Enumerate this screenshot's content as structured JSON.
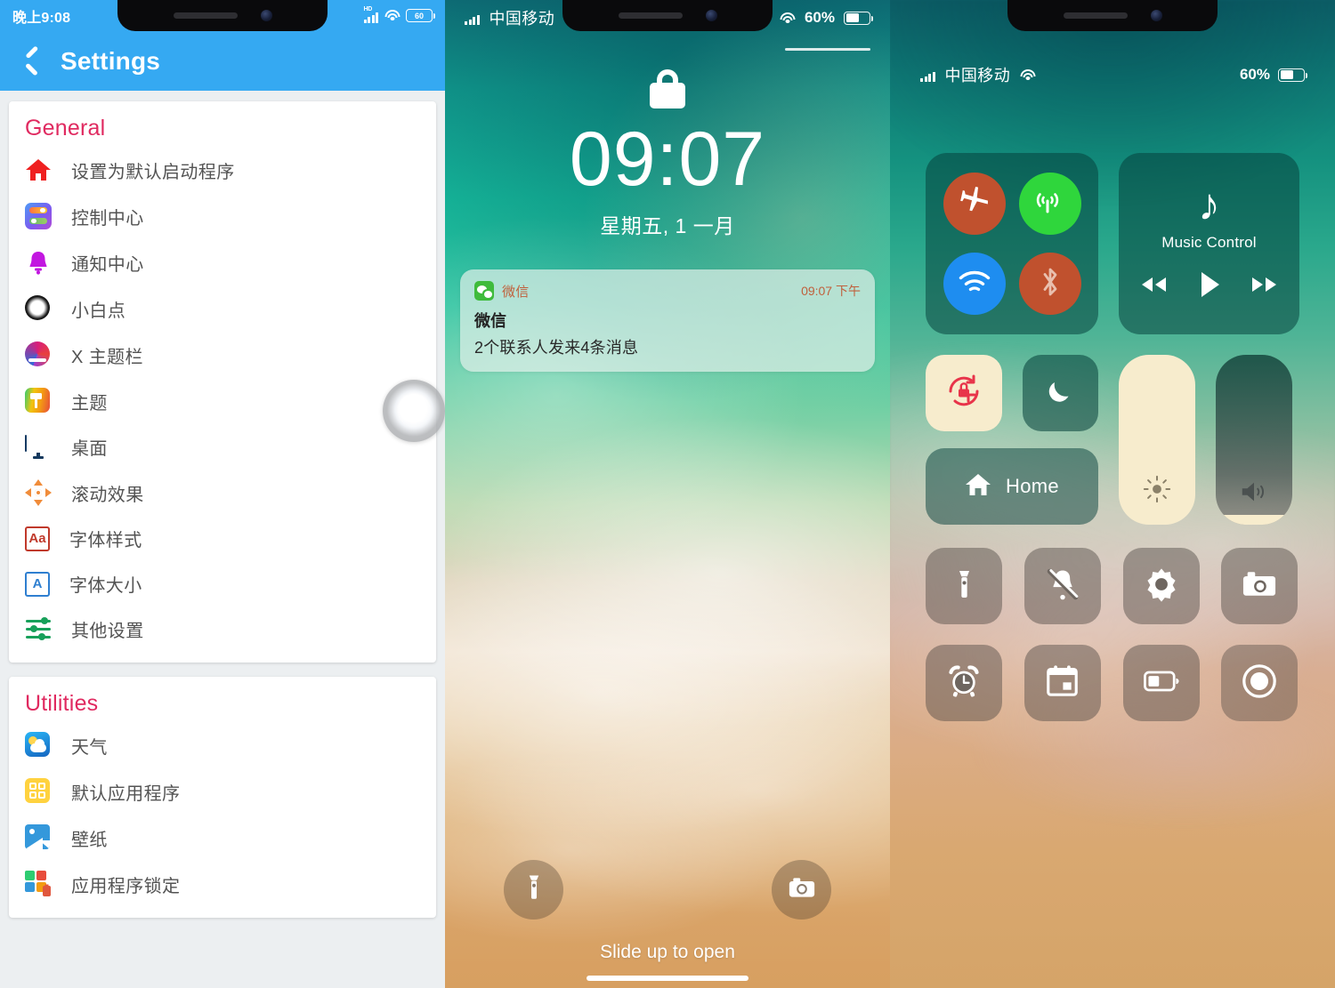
{
  "panel_settings": {
    "status_bar": {
      "time": "晚上9:08",
      "network_label": "HD",
      "signal_icon": "signal-bars-icon",
      "wifi_icon": "wifi-icon",
      "battery_level": "60"
    },
    "header": {
      "back_icon": "back-chevron-icon",
      "title": "Settings"
    },
    "sections": [
      {
        "title": "General",
        "items": [
          {
            "icon": "home-icon",
            "label": "设置为默认启动程序"
          },
          {
            "icon": "control-center-icon",
            "label": "控制中心"
          },
          {
            "icon": "bell-icon",
            "label": "通知中心"
          },
          {
            "icon": "assistive-touch-icon",
            "label": "小白点"
          },
          {
            "icon": "x-status-bar-icon",
            "label": "X 主题栏"
          },
          {
            "icon": "theme-paint-icon",
            "label": "主题"
          },
          {
            "icon": "desktop-monitor-icon",
            "label": "桌面"
          },
          {
            "icon": "scroll-effect-icon",
            "label": "滚动效果"
          },
          {
            "icon": "font-style-icon",
            "label": "字体样式",
            "glyph": "Aa"
          },
          {
            "icon": "font-size-icon",
            "label": "字体大小",
            "glyph": "A"
          },
          {
            "icon": "sliders-icon",
            "label": "其他设置"
          }
        ]
      },
      {
        "title": "Utilities",
        "items": [
          {
            "icon": "weather-icon",
            "label": "天气"
          },
          {
            "icon": "default-apps-icon",
            "label": "默认应用程序"
          },
          {
            "icon": "wallpaper-icon",
            "label": "壁纸"
          },
          {
            "icon": "app-lock-icon",
            "label": "应用程序锁定"
          }
        ]
      }
    ],
    "accent_color": "#e02a60",
    "header_color": "#35a9f2",
    "assistive_touch": {
      "icon": "assistive-touch-button"
    }
  },
  "panel_lockscreen": {
    "status_bar": {
      "signal_icon": "signal-bars-icon",
      "carrier": "中国移动",
      "wifi_icon": "wifi-icon",
      "battery_percent": "60%",
      "battery_level": 60
    },
    "lock_icon": "padlock-icon",
    "clock": {
      "time": "09:07",
      "date": "星期五, 1 一月"
    },
    "notification": {
      "app_icon": "wechat-icon",
      "app_name": "微信",
      "time": "09:07 下午",
      "title": "微信",
      "message": "2个联系人发来4条消息"
    },
    "shortcuts": [
      {
        "icon": "flashlight-icon",
        "name": "flashlight"
      },
      {
        "icon": "camera-icon",
        "name": "camera"
      }
    ],
    "slide_hint": "Slide up to open",
    "home_indicator": "home-bar"
  },
  "panel_controlcenter": {
    "status_bar": {
      "signal_icon": "signal-bars-icon",
      "carrier": "中国移动",
      "wifi_icon": "wifi-icon",
      "battery_percent": "60%",
      "battery_level": 60
    },
    "connectivity": [
      {
        "icon": "airplane-mode-icon",
        "name": "airplane-mode",
        "state": "off",
        "color": "#c0512e"
      },
      {
        "icon": "cellular-data-icon",
        "name": "cellular-data",
        "state": "on",
        "color": "#2fd63c"
      },
      {
        "icon": "wifi-icon",
        "name": "wifi",
        "state": "on",
        "color": "#1e8df0"
      },
      {
        "icon": "bluetooth-icon",
        "name": "bluetooth",
        "state": "off",
        "color": "#c0512e"
      }
    ],
    "music": {
      "icon": "music-note-icon",
      "label": "Music Control",
      "prev": "rewind-icon",
      "play": "play-icon",
      "next": "fast-forward-icon"
    },
    "toggles": [
      {
        "icon": "rotation-lock-icon",
        "name": "rotation-lock",
        "state": "on"
      },
      {
        "icon": "moon-icon",
        "name": "do-not-disturb",
        "state": "off"
      }
    ],
    "home_tile": {
      "icon": "home-icon",
      "label": "Home"
    },
    "sliders": [
      {
        "icon": "brightness-icon",
        "name": "brightness",
        "value": 100
      },
      {
        "icon": "volume-icon",
        "name": "volume",
        "value": 6
      }
    ],
    "utilities": [
      {
        "icon": "flashlight-icon",
        "name": "flashlight"
      },
      {
        "icon": "mute-bell-icon",
        "name": "silent-mode"
      },
      {
        "icon": "brightness-icon",
        "name": "brightness-shortcut"
      },
      {
        "icon": "camera-icon",
        "name": "camera"
      },
      {
        "icon": "alarm-clock-icon",
        "name": "alarm"
      },
      {
        "icon": "calendar-icon",
        "name": "calendar"
      },
      {
        "icon": "battery-icon",
        "name": "low-power-mode"
      },
      {
        "icon": "record-icon",
        "name": "screen-record"
      }
    ]
  }
}
